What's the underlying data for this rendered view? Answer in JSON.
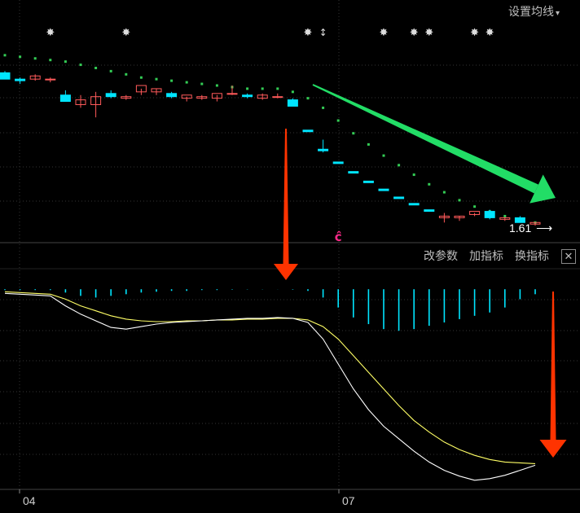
{
  "toolbar": {
    "ma_settings_label": "设置均线",
    "ma_settings_caret": "▾",
    "edit_params_label": "改参数",
    "add_indicator_label": "加指标",
    "switch_indicator_label": "换指标",
    "close_label": "✕"
  },
  "colors": {
    "background": "#000000",
    "up": "#ff5a5a",
    "down": "#00e5ff",
    "dot": "#33cc55",
    "signal_line": "#ffff66",
    "main_line": "#ffffff",
    "arrow_red": "#ff3300",
    "arrow_green": "#22dd66",
    "grid": "#333333"
  },
  "chart_data": {
    "type": "candlestick",
    "x_tick_labels": [
      "04",
      "07"
    ],
    "last_price_label": "1.61",
    "marker_glyph": "✸",
    "special_glyph": "↕",
    "ce_glyph": "ĉ",
    "candles": [
      {
        "o": 100,
        "h": 101,
        "l": 96,
        "c": 96
      },
      {
        "o": 96,
        "h": 97,
        "l": 93,
        "c": 95
      },
      {
        "o": 96,
        "h": 99,
        "l": 95,
        "c": 98
      },
      {
        "o": 96,
        "h": 97,
        "l": 94,
        "c": 96
      },
      {
        "o": 86,
        "h": 89,
        "l": 84,
        "c": 82
      },
      {
        "o": 80,
        "h": 86,
        "l": 78,
        "c": 83
      },
      {
        "o": 80,
        "h": 88,
        "l": 72,
        "c": 85
      },
      {
        "o": 87,
        "h": 89,
        "l": 84,
        "c": 85
      },
      {
        "o": 84,
        "h": 86,
        "l": 83,
        "c": 85
      },
      {
        "o": 88,
        "h": 90,
        "l": 86,
        "c": 92
      },
      {
        "o": 88,
        "h": 90,
        "l": 86,
        "c": 90
      },
      {
        "o": 87,
        "h": 88,
        "l": 84,
        "c": 85
      },
      {
        "o": 84,
        "h": 85,
        "l": 82,
        "c": 86
      },
      {
        "o": 84,
        "h": 86,
        "l": 83,
        "c": 85
      },
      {
        "o": 84,
        "h": 86,
        "l": 82,
        "c": 87
      },
      {
        "o": 87,
        "h": 92,
        "l": 86,
        "c": 87
      },
      {
        "o": 86,
        "h": 87,
        "l": 84,
        "c": 85
      },
      {
        "o": 84,
        "h": 87,
        "l": 83,
        "c": 86
      },
      {
        "o": 85,
        "h": 87,
        "l": 84,
        "c": 85
      },
      {
        "o": 83,
        "h": 84,
        "l": 80,
        "c": 79
      },
      {
        "o": 64,
        "h": 64,
        "l": 64,
        "c": 63
      },
      {
        "o": 52,
        "h": 58,
        "l": 50,
        "c": 51
      },
      {
        "o": 44,
        "h": 44,
        "l": 44,
        "c": 43
      },
      {
        "o": 38,
        "h": 38,
        "l": 38,
        "c": 37
      },
      {
        "o": 32,
        "h": 32,
        "l": 32,
        "c": 31
      },
      {
        "o": 27,
        "h": 27,
        "l": 27,
        "c": 26
      },
      {
        "o": 22,
        "h": 22,
        "l": 22,
        "c": 21
      },
      {
        "o": 18,
        "h": 18,
        "l": 18,
        "c": 17
      },
      {
        "o": 14,
        "h": 14,
        "l": 14,
        "c": 13
      },
      {
        "o": 9,
        "h": 12,
        "l": 6,
        "c": 10
      },
      {
        "o": 9,
        "h": 10,
        "l": 7,
        "c": 10
      },
      {
        "o": 11,
        "h": 12,
        "l": 10,
        "c": 13
      },
      {
        "o": 13,
        "h": 14,
        "l": 8,
        "c": 9
      },
      {
        "o": 8,
        "h": 9,
        "l": 7,
        "c": 9
      },
      {
        "o": 9,
        "h": 10,
        "l": 6,
        "c": 6
      },
      {
        "o": 5,
        "h": 6,
        "l": 4,
        "c": 6
      }
    ],
    "dots": [
      [
        0,
        111
      ],
      [
        1,
        110
      ],
      [
        2,
        109
      ],
      [
        3,
        108
      ],
      [
        4,
        107
      ],
      [
        5,
        105
      ],
      [
        6,
        103
      ],
      [
        7,
        101
      ],
      [
        8,
        99
      ],
      [
        9,
        97
      ],
      [
        10,
        96
      ],
      [
        11,
        95
      ],
      [
        12,
        94
      ],
      [
        13,
        93
      ],
      [
        14,
        92
      ],
      [
        15,
        91
      ],
      [
        16,
        90
      ],
      [
        17,
        90
      ],
      [
        18,
        90
      ],
      [
        19,
        88
      ],
      [
        20,
        84
      ],
      [
        21,
        78
      ],
      [
        22,
        70
      ],
      [
        23,
        62
      ],
      [
        24,
        55
      ],
      [
        25,
        48
      ],
      [
        26,
        42
      ],
      [
        27,
        36
      ],
      [
        28,
        30
      ],
      [
        29,
        25
      ],
      [
        30,
        20
      ],
      [
        31,
        16
      ],
      [
        32,
        13
      ],
      [
        33,
        10
      ],
      [
        34,
        8
      ],
      [
        35,
        6
      ]
    ],
    "markers": [
      3,
      8,
      20,
      25,
      27,
      28,
      31,
      32
    ],
    "special_marker_index": 21,
    "ce_marker_index": 22,
    "macd": {
      "hist": [
        -1,
        -1,
        -1,
        -1,
        -4,
        -8,
        -10,
        -8,
        -6,
        -4,
        -3,
        -2,
        -2,
        -1,
        -1,
        -0.5,
        -0.3,
        -0.2,
        -0.1,
        -0.5,
        -2,
        -10,
        -22,
        -34,
        -42,
        -48,
        -50,
        -48,
        -44,
        -40,
        -36,
        -32,
        -28,
        -22,
        -12,
        -6
      ],
      "dif": [
        -5,
        -6,
        -7,
        -8,
        -20,
        -30,
        -38,
        -46,
        -48,
        -45,
        -42,
        -40,
        -39,
        -38,
        -37,
        -36,
        -35,
        -35,
        -34,
        -35,
        -40,
        -60,
        -90,
        -120,
        -145,
        -165,
        -180,
        -195,
        -208,
        -218,
        -225,
        -230,
        -228,
        -224,
        -218,
        -212
      ],
      "dea": [
        -3,
        -4,
        -5,
        -6,
        -12,
        -20,
        -26,
        -32,
        -36,
        -38,
        -39,
        -39,
        -38,
        -38,
        -37,
        -37,
        -36,
        -36,
        -35,
        -35,
        -37,
        -45,
        -60,
        -80,
        -100,
        -120,
        -140,
        -158,
        -172,
        -184,
        -193,
        -200,
        -205,
        -208,
        -209,
        -210
      ],
      "ylim": [
        -240,
        10
      ]
    }
  }
}
